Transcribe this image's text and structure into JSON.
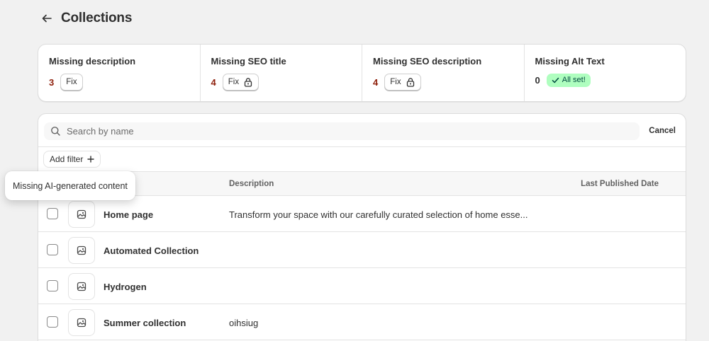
{
  "header": {
    "title": "Collections",
    "back_icon": "arrow-left-icon"
  },
  "stats": [
    {
      "label": "Missing description",
      "count": "3",
      "action": "Fix",
      "locked": false
    },
    {
      "label": "Missing SEO title",
      "count": "4",
      "action": "Fix",
      "locked": true
    },
    {
      "label": "Missing SEO description",
      "count": "4",
      "action": "Fix",
      "locked": true
    },
    {
      "label": "Missing Alt Text",
      "count": "0",
      "badge": "All set!"
    }
  ],
  "search": {
    "placeholder": "Search by name",
    "value": "",
    "cancel_label": "Cancel"
  },
  "filter": {
    "add_label": "Add filter"
  },
  "table": {
    "columns": [
      "Description",
      "Last Published Date"
    ],
    "rows": [
      {
        "title": "Home page",
        "description": "Transform your space with our carefully curated selection of home esse...",
        "published": ""
      },
      {
        "title": "Automated Collection",
        "description": "",
        "published": ""
      },
      {
        "title": "Hydrogen",
        "description": "",
        "published": ""
      },
      {
        "title": "Summer collection",
        "description": "oihsiug",
        "published": ""
      }
    ]
  },
  "tooltip": {
    "text": "Missing AI-generated content"
  },
  "colors": {
    "background": "#f1f1f1",
    "count_alert": "#8e1f0b",
    "success_badge": "#affebf",
    "success_text": "#014b40"
  }
}
